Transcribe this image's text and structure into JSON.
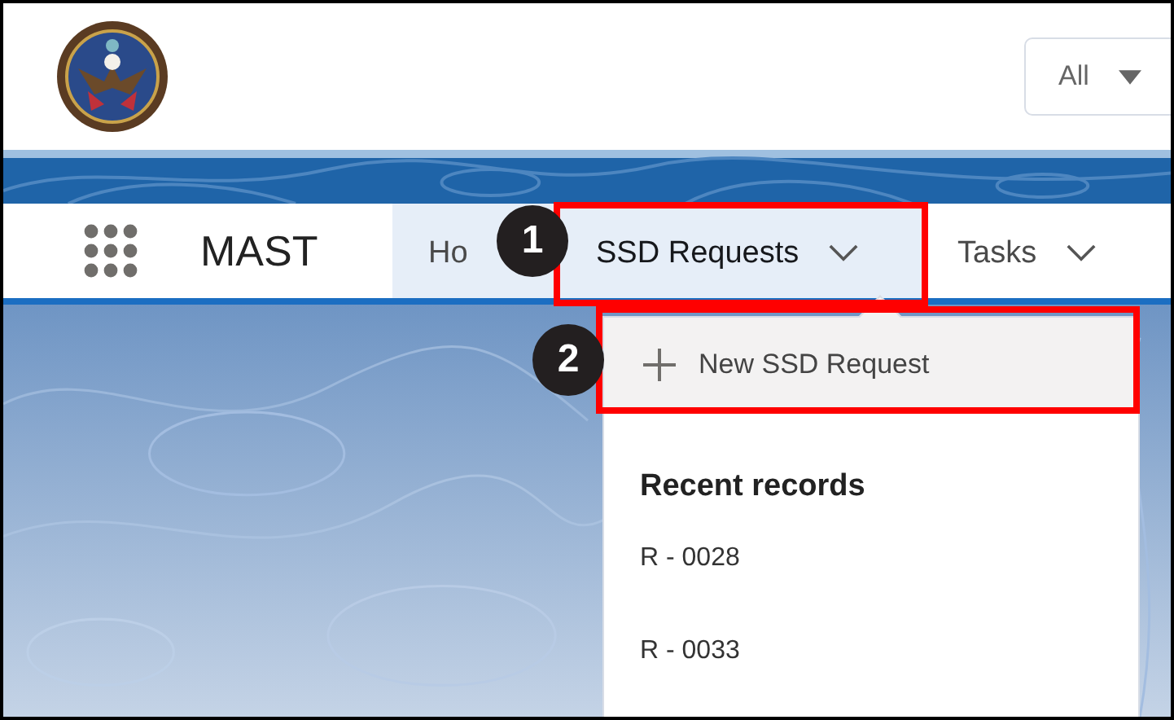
{
  "header": {
    "search_scope": "All"
  },
  "app": {
    "name": "MAST"
  },
  "tabs": [
    {
      "label": "Ho",
      "selected": false,
      "highlighted": true,
      "has_menu": false
    },
    {
      "label": "SSD Requests",
      "selected": true,
      "highlighted": true,
      "has_menu": true
    },
    {
      "label": "Tasks",
      "selected": false,
      "highlighted": false,
      "has_menu": true
    }
  ],
  "menu": {
    "action": "New SSD Request",
    "section_title": "Recent records",
    "records": [
      "R - 0028",
      "R - 0033"
    ]
  },
  "callouts": [
    {
      "number": "1"
    },
    {
      "number": "2"
    }
  ]
}
